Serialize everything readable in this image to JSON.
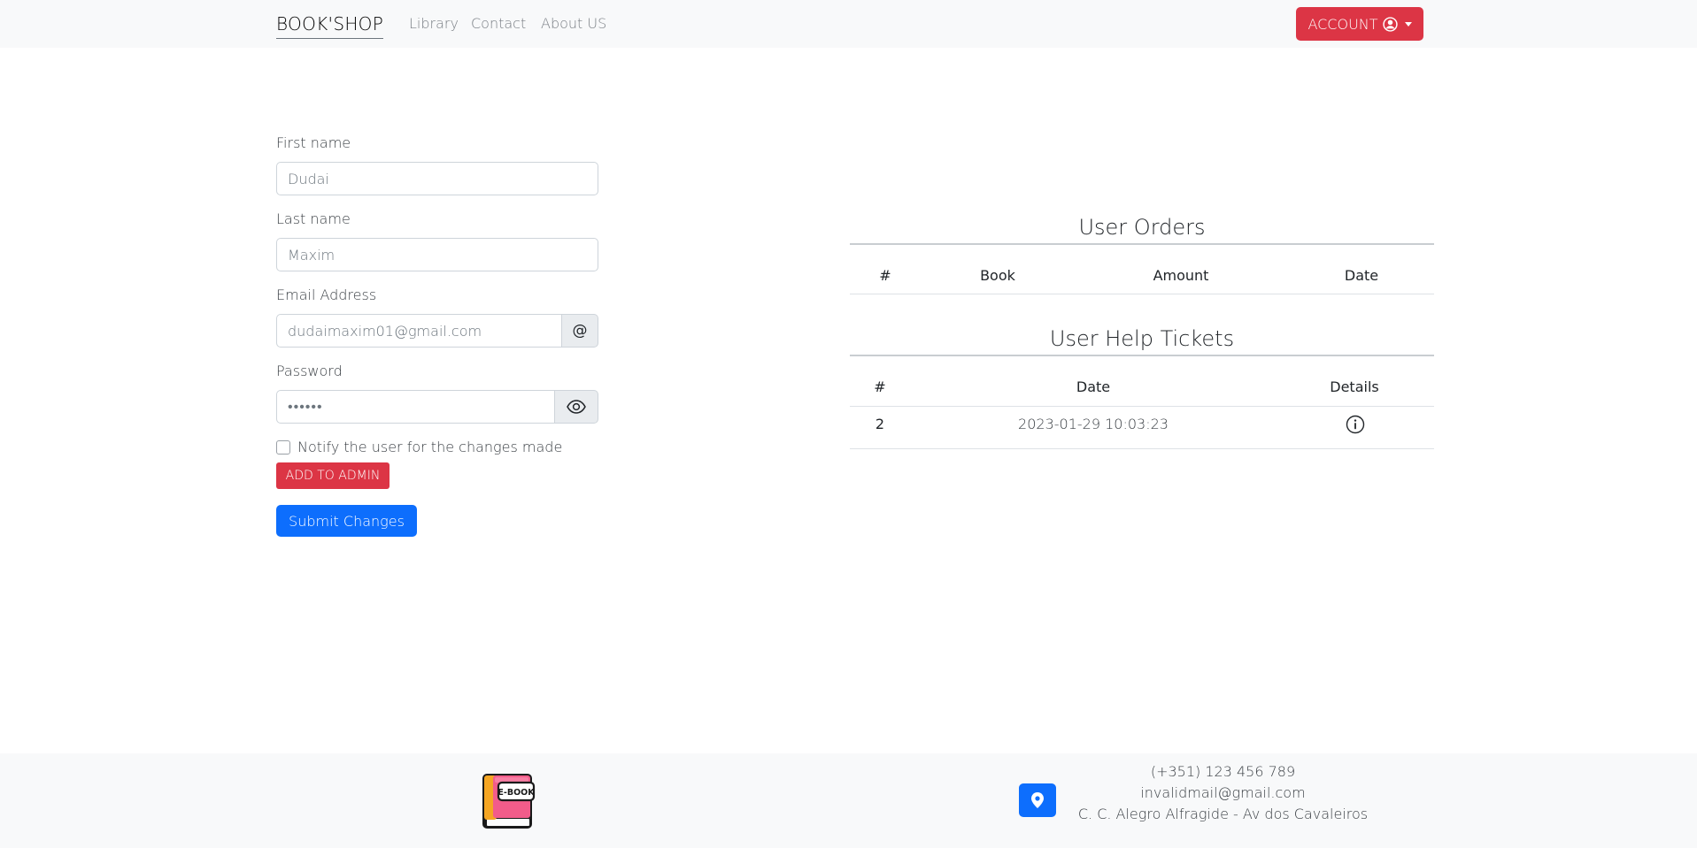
{
  "navbar": {
    "brand": "BOOK'SHOP",
    "links": [
      "Library",
      "Contact",
      "About US"
    ],
    "account_label": "ACCOUNT"
  },
  "form": {
    "first_name": {
      "label": "First name",
      "value": "Dudai"
    },
    "last_name": {
      "label": "Last name",
      "value": "Maxim"
    },
    "email": {
      "label": "Email Address",
      "value": "dudaimaxim01@gmail.com",
      "addon": "@"
    },
    "password": {
      "label": "Password",
      "value": "••••••"
    },
    "notify_label": "Notify the user for the changes made",
    "notify_checked": false,
    "add_admin_label": "ADD TO ADMIN",
    "submit_label": "Submit Changes"
  },
  "orders": {
    "title": "User Orders",
    "columns": [
      "#",
      "Book",
      "Amount",
      "Date"
    ],
    "rows": []
  },
  "tickets": {
    "title": "User Help Tickets",
    "columns": [
      "#",
      "Date",
      "Details"
    ],
    "rows": [
      {
        "num": "2",
        "date": "2023-01-29 10:03:23",
        "details_icon": "info-circle-icon"
      }
    ]
  },
  "footer": {
    "logo_text": "E-BOOK",
    "phone": "(+351) 123 456 789",
    "email": "invalidmail@gmail.com",
    "address": "C. C. Alegro Alfragide - Av dos Cavaleiros"
  },
  "colors": {
    "danger": "#dc3545",
    "primary": "#0d6efd",
    "light": "#f8f9fa"
  }
}
